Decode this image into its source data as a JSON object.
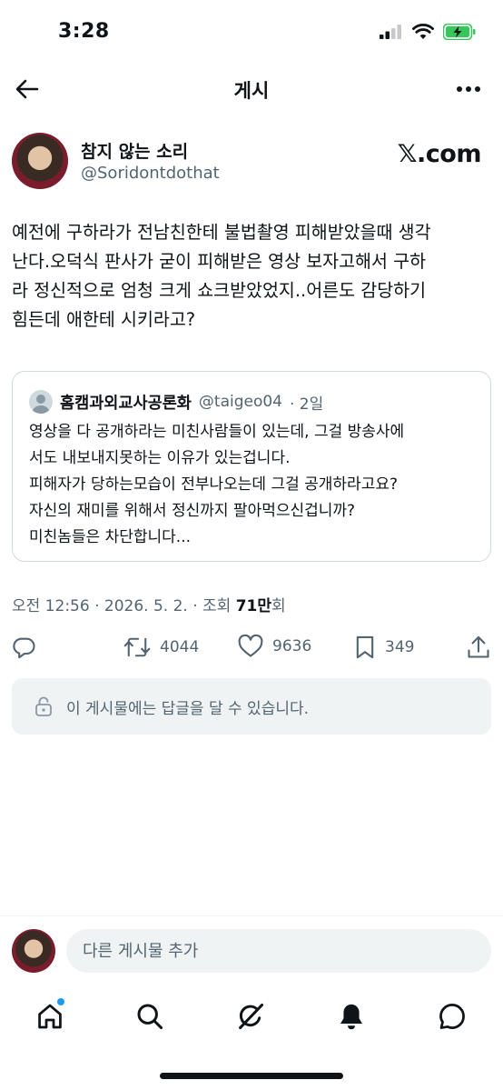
{
  "status_bar": {
    "time": "3:28"
  },
  "nav": {
    "title": "게시",
    "back_icon": "back-arrow-icon",
    "more_icon": "more-icon"
  },
  "post": {
    "author_name": "참지 않는 소리",
    "author_handle": "@Soridontdothat",
    "source": "𝕏.com",
    "text": "예전에 구하라가 전남친한테 불법촬영 피해받았을때 생각\n난다.오덕식 판사가 굳이 피해받은 영상 보자고해서 구하\n라 정신적으로 엄청 크게 쇼크받았었지..어른도 감당하기\n힘든데 애한테 시키라고?",
    "quote": {
      "author_name": "홈캠과외교사공론화",
      "author_handle": "@taigeo04",
      "age": "· 2일",
      "text": "영상을 다 공개하라는 미친사람들이 있는데, 그걸 방송사에\n서도 내보내지못하는 이유가 있는겁니다.\n피해자가 당하는모습이 전부나오는데 그걸 공개하라고요?\n자신의 재미를 위해서 정신까지 팔아먹으신겁니까?\n미친놈들은 차단합니다..."
    },
    "meta": {
      "time_date": "오전 12:56 · 2026. 5. 2. · 조회 ",
      "views": "71만",
      "views_suffix": "회"
    },
    "actions": {
      "retweets": "4044",
      "likes": "9636",
      "bookmarks": "349"
    },
    "reply_notice": "이 게시물에는 답글을 달 수 있습니다."
  },
  "composer": {
    "placeholder": "다른 게시물 추가"
  },
  "tabs": [
    "home-icon",
    "search-icon",
    "grok-icon",
    "notifications-icon",
    "messages-icon"
  ],
  "colors": {
    "text": "#0f1419",
    "secondary": "#536471",
    "accent": "#1d9bf0",
    "border": "#cfd9de",
    "battery": "#34c759"
  }
}
